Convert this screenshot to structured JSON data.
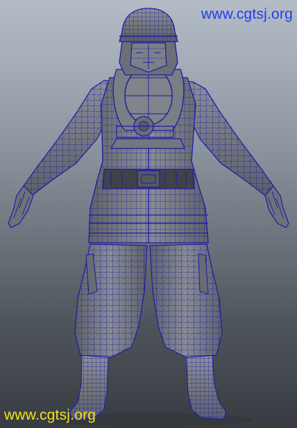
{
  "scene": {
    "subject": "firefighter-wireframe-model",
    "wireframe_color": "#1c1aa8",
    "shading_color": "#6e7278",
    "background_top": "#b4bcc6",
    "background_bottom": "#383c42"
  },
  "watermarks": {
    "top_text": "www.cgtsj.org",
    "top_color": "#1e3ef0",
    "bottom_text": "www.cgtsj.org",
    "bottom_color": "#f2e21a"
  }
}
